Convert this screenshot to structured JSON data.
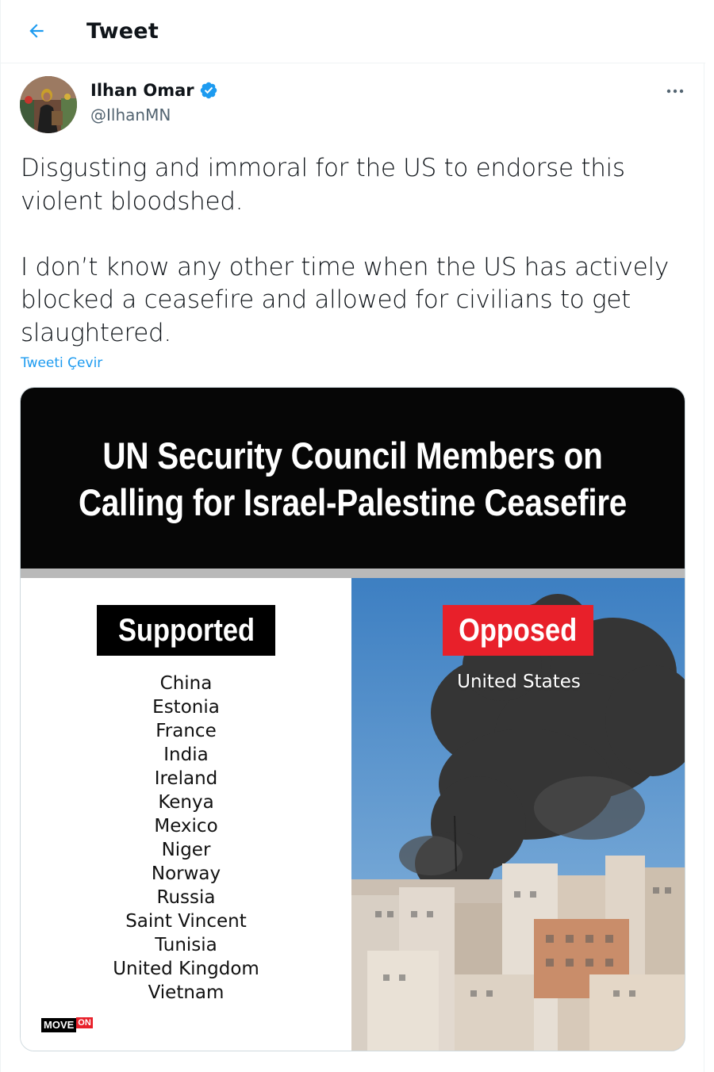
{
  "header": {
    "title": "Tweet",
    "back_icon": "arrow-left-icon"
  },
  "author": {
    "name": "Ilhan Omar",
    "handle": "@IlhanMN",
    "verified": true,
    "verified_icon": "verified-badge-icon"
  },
  "more_icon": "more-horizontal-icon",
  "tweet": {
    "text": "Disgusting and immoral for the US to endorse this\nviolent bloodshed.\n\nI don’t know any other time when the US has actively\nblocked a ceasefire and allowed for civilians to get\nslaughtered.",
    "translate_label": "Tweeti Çevir"
  },
  "media": {
    "title_line1": "UN Security Council Members on",
    "title_line2": "Calling for Israel-Palestine Ceasefire",
    "supported_label": "Supported",
    "supported_countries": [
      "China",
      "Estonia",
      "France",
      "India",
      "Ireland",
      "Kenya",
      "Mexico",
      "Niger",
      "Norway",
      "Russia",
      "Saint Vincent",
      "Tunisia",
      "United Kingdom",
      "Vietnam"
    ],
    "opposed_label": "Opposed",
    "opposed_countries": [
      "United States"
    ],
    "logo_text_a": "MOVE",
    "logo_text_b": "ON"
  },
  "colors": {
    "link_blue": "#1d9bf0",
    "verified_blue": "#1d9bf0",
    "opposed_red": "#e8202a",
    "handle_gray": "#536471"
  }
}
